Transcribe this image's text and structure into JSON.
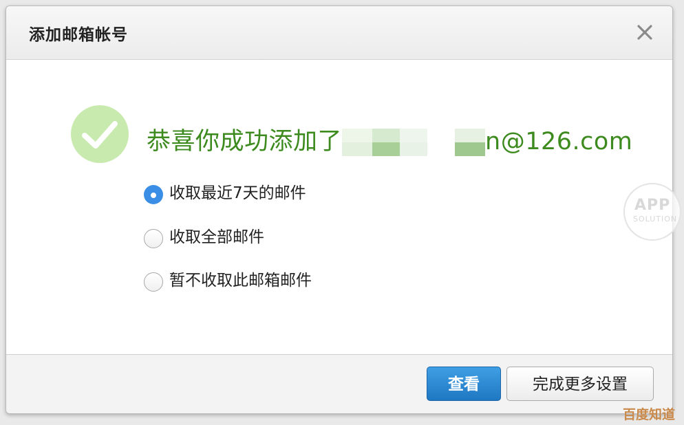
{
  "dialog": {
    "title": "添加邮箱帐号",
    "close_icon": "close-icon"
  },
  "success": {
    "icon": "checkmark-circle-icon",
    "prefix": "恭喜你成功添加了",
    "suffix": "n@126.com",
    "color": "#3d8b1e"
  },
  "options": [
    {
      "label": "收取最近7天的邮件",
      "checked": true
    },
    {
      "label": "收取全部邮件",
      "checked": false
    },
    {
      "label": "暂不收取此邮箱邮件",
      "checked": false
    }
  ],
  "buttons": {
    "view": "查看",
    "more_settings": "完成更多设置"
  },
  "watermarks": {
    "app_line1": "APP",
    "app_line2": "SOLUTION",
    "baidu": "百度知道"
  }
}
